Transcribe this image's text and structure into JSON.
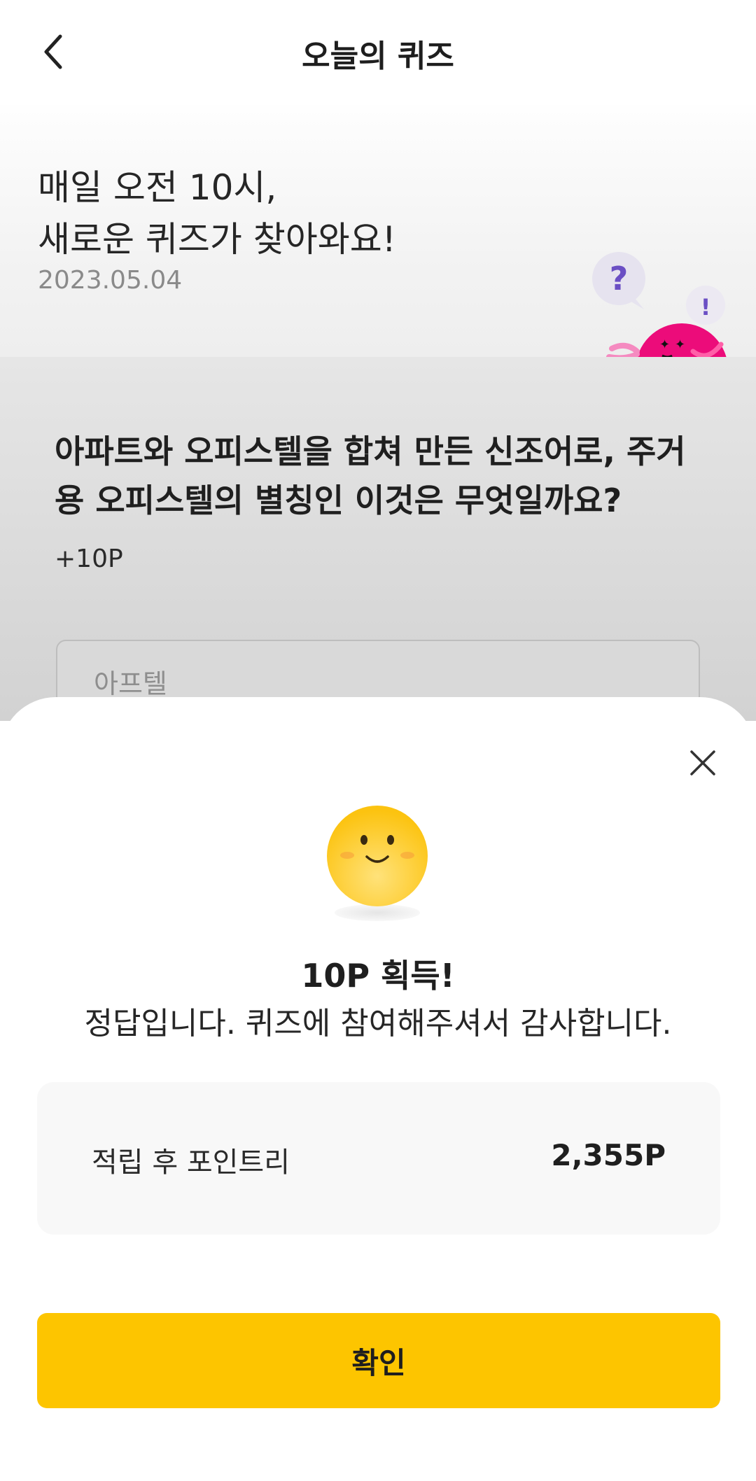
{
  "header": {
    "title": "오늘의 퀴즈"
  },
  "hero": {
    "line1": "매일 오전 10시,",
    "line2": "새로운 퀴즈가 찾아와요!",
    "date": "2023.05.04",
    "mascot_bubbles": [
      "?",
      "!"
    ]
  },
  "quiz": {
    "question": "아파트와 오피스텔을 합쳐 만든 신조어로, 주거용 오피스텔의 별칭인 이것은 무엇일까요?",
    "reward": "+10P",
    "answer": "아프텔"
  },
  "result": {
    "title": "10P 획득!",
    "message": "정답입니다. 퀴즈에 참여해주셔서 감사합니다.",
    "points_label": "적립 후 포인트리",
    "points_value": "2,355P",
    "confirm_label": "확인"
  },
  "colors": {
    "accent_button": "#fdc500",
    "mascot_pink": "#ec0c7a",
    "emoji_yellow": "#fcc817"
  }
}
